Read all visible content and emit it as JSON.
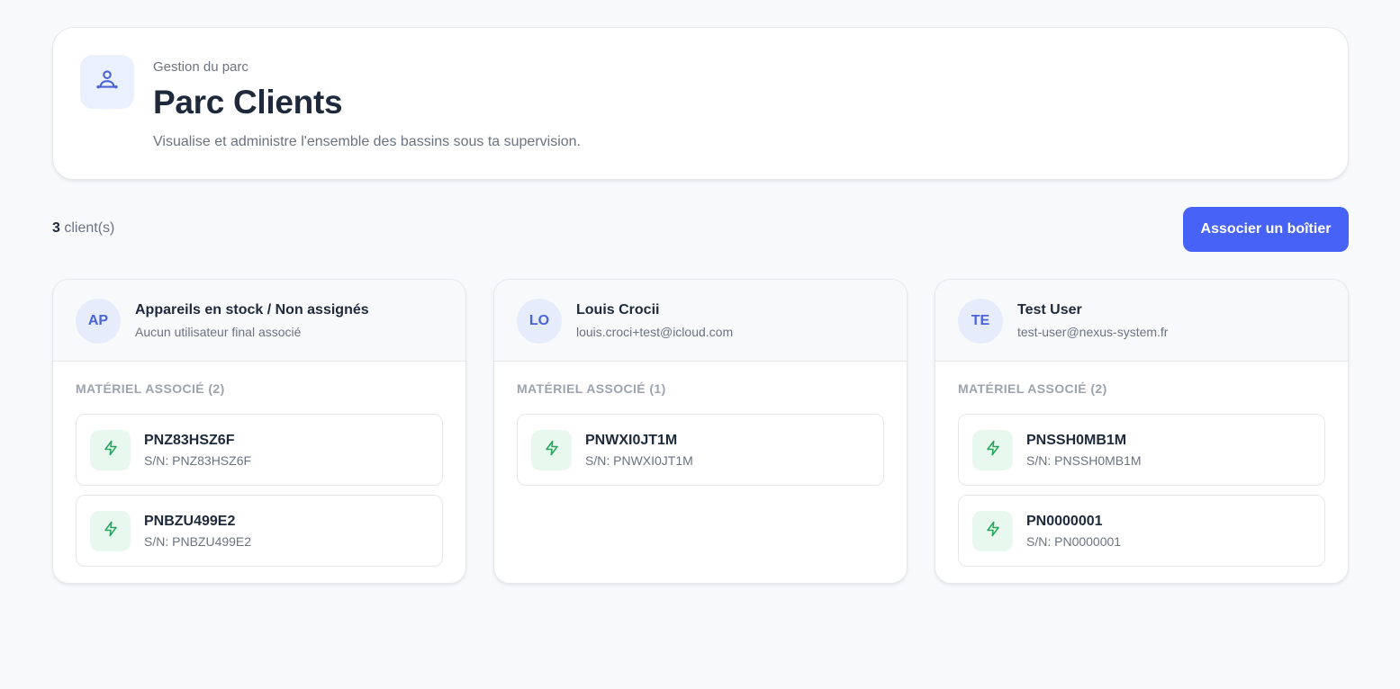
{
  "header": {
    "eyebrow": "Gestion du parc",
    "title": "Parc Clients",
    "subtitle": "Visualise et administre l'ensemble des bassins sous ta supervision.",
    "icon": "user-network-icon"
  },
  "toolbar": {
    "count_value": "3",
    "count_label": " client(s)",
    "associate_label": "Associer un boîtier"
  },
  "colors": {
    "accent": "#4762f7",
    "avatar_bg": "#e6ecfb",
    "device_icon_bg": "#e9f8ee",
    "device_icon": "#22a55a"
  },
  "clients": [
    {
      "initials": "AP",
      "name": "Appareils en stock / Non assignés",
      "subtitle": "Aucun utilisateur final associé",
      "equipment_label": "MATÉRIEL ASSOCIÉ (2)",
      "devices": [
        {
          "name": "PNZ83HSZ6F",
          "serial": "S/N: PNZ83HSZ6F",
          "icon": "lightning-icon"
        },
        {
          "name": "PNBZU499E2",
          "serial": "S/N: PNBZU499E2",
          "icon": "lightning-icon"
        }
      ]
    },
    {
      "initials": "LO",
      "name": "Louis Crocii",
      "subtitle": "louis.croci+test@icloud.com",
      "equipment_label": "MATÉRIEL ASSOCIÉ (1)",
      "devices": [
        {
          "name": "PNWXI0JT1M",
          "serial": "S/N: PNWXI0JT1M",
          "icon": "lightning-icon"
        }
      ]
    },
    {
      "initials": "TE",
      "name": "Test User",
      "subtitle": "test-user@nexus-system.fr",
      "equipment_label": "MATÉRIEL ASSOCIÉ (2)",
      "devices": [
        {
          "name": "PNSSH0MB1M",
          "serial": "S/N: PNSSH0MB1M",
          "icon": "lightning-icon"
        },
        {
          "name": "PN0000001",
          "serial": "S/N: PN0000001",
          "icon": "lightning-icon"
        }
      ]
    }
  ]
}
